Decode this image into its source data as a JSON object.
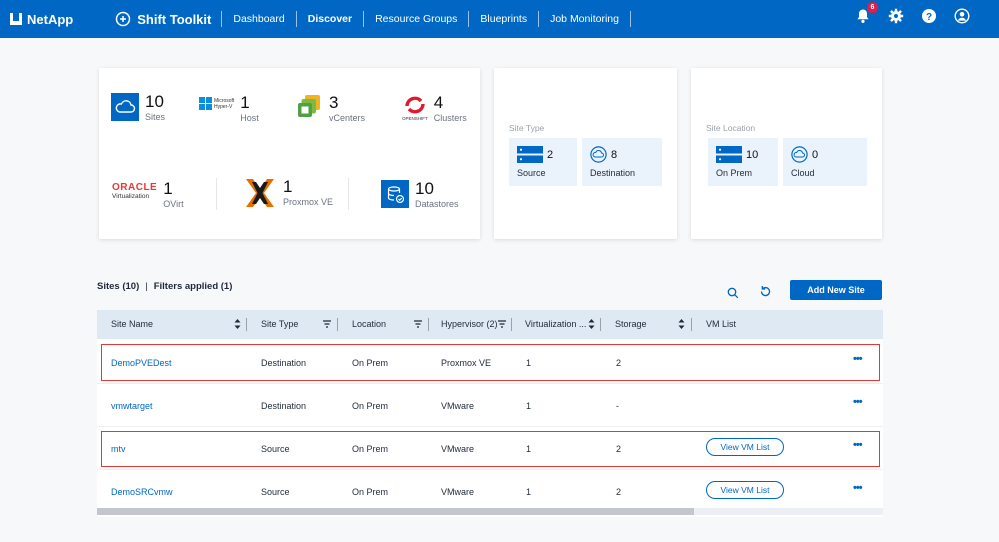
{
  "topbar": {
    "brand": "NetApp",
    "product": "Shift Toolkit",
    "nav": [
      "Dashboard",
      "Discover",
      "Resource Groups",
      "Blueprints",
      "Job Monitoring"
    ],
    "notification_count": "6"
  },
  "summary": {
    "metrics": [
      {
        "value": "10",
        "label": "Sites"
      },
      {
        "value": "1",
        "label": "Host"
      },
      {
        "value": "3",
        "label": "vCenters"
      },
      {
        "value": "4",
        "label": "Clusters"
      },
      {
        "value": "1",
        "label": "OVirt"
      },
      {
        "value": "1",
        "label": "Proxmox VE"
      },
      {
        "value": "10",
        "label": "Datastores"
      }
    ],
    "logos": {
      "hyperv_line1": "Microsoft",
      "hyperv_line2": "Hyper-V",
      "openshift": "OPENSHIFT",
      "oracle_line1": "ORACLE",
      "oracle_line2": "Virtualization"
    }
  },
  "site_type": {
    "label": "Site Type",
    "tiles": [
      {
        "value": "2",
        "label": "Source"
      },
      {
        "value": "8",
        "label": "Destination"
      }
    ]
  },
  "site_location": {
    "label": "Site Location",
    "tiles": [
      {
        "value": "10",
        "label": "On Prem"
      },
      {
        "value": "0",
        "label": "Cloud"
      }
    ]
  },
  "sites": {
    "title": "Sites (10)",
    "filters": "Filters applied (1)",
    "add_button": "Add New Site",
    "columns": [
      "Site Name",
      "Site Type",
      "Location",
      "Hypervisor (2)",
      "Virtualization ...",
      "Storage",
      "VM List"
    ],
    "rows": [
      {
        "name": "DemoPVEDest",
        "type": "Destination",
        "location": "On Prem",
        "hypervisor": "Proxmox VE",
        "virtualization": "1",
        "storage": "2",
        "vm_list": ""
      },
      {
        "name": "vmwtarget",
        "type": "Destination",
        "location": "On Prem",
        "hypervisor": "VMware",
        "virtualization": "1",
        "storage": "-",
        "vm_list": ""
      },
      {
        "name": "mtv",
        "type": "Source",
        "location": "On Prem",
        "hypervisor": "VMware",
        "virtualization": "1",
        "storage": "2",
        "vm_list": "View VM List"
      },
      {
        "name": "DemoSRCvmw",
        "type": "Source",
        "location": "On Prem",
        "hypervisor": "VMware",
        "virtualization": "1",
        "storage": "2",
        "vm_list": "View VM List"
      }
    ],
    "more": "•••"
  }
}
